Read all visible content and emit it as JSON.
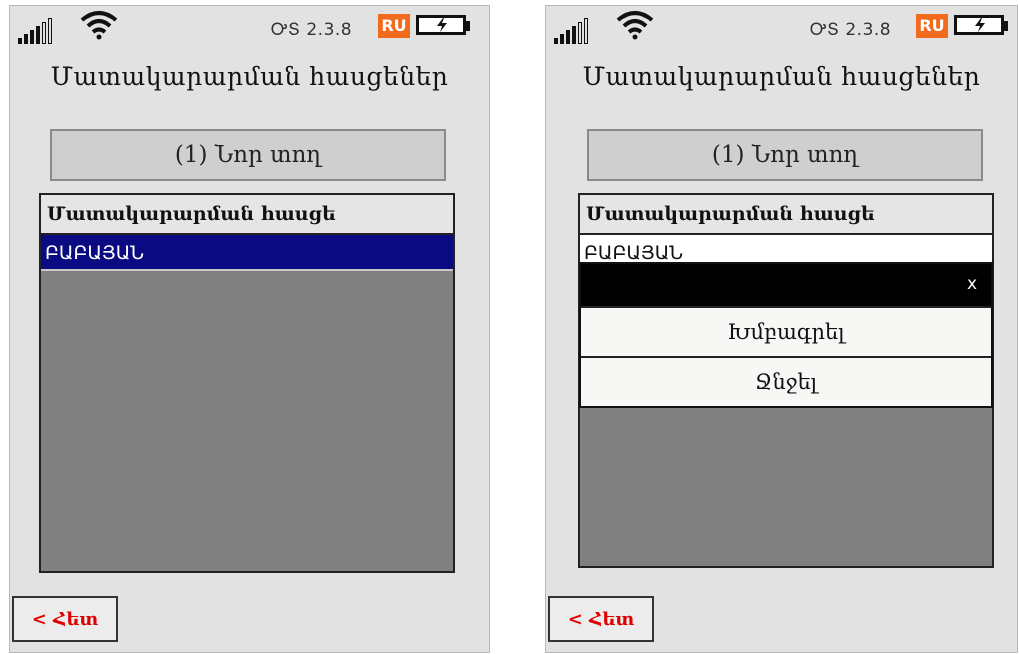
{
  "status_bar": {
    "os_version": "ᎤՏ 2.3.8",
    "language": "RU",
    "icons": [
      "signal-bars-icon",
      "wifi-icon",
      "battery-charging-icon"
    ],
    "lang_badge_color": "#f26a1b"
  },
  "page": {
    "title": "Մատակարարման հասցեներ",
    "new_row_button": "(1) Նոր տող",
    "table": {
      "header": "Մատակարարման հասցե",
      "rows": [
        "ԲԱԲԱՅԱՆ"
      ]
    },
    "back_button": "< Հետ"
  },
  "popup": {
    "close": "x",
    "items": [
      "Խմբագրել",
      "Ջնջել"
    ]
  },
  "colors": {
    "selection": "#0a0a82",
    "back_text": "#e00000",
    "list_background": "#808080"
  }
}
